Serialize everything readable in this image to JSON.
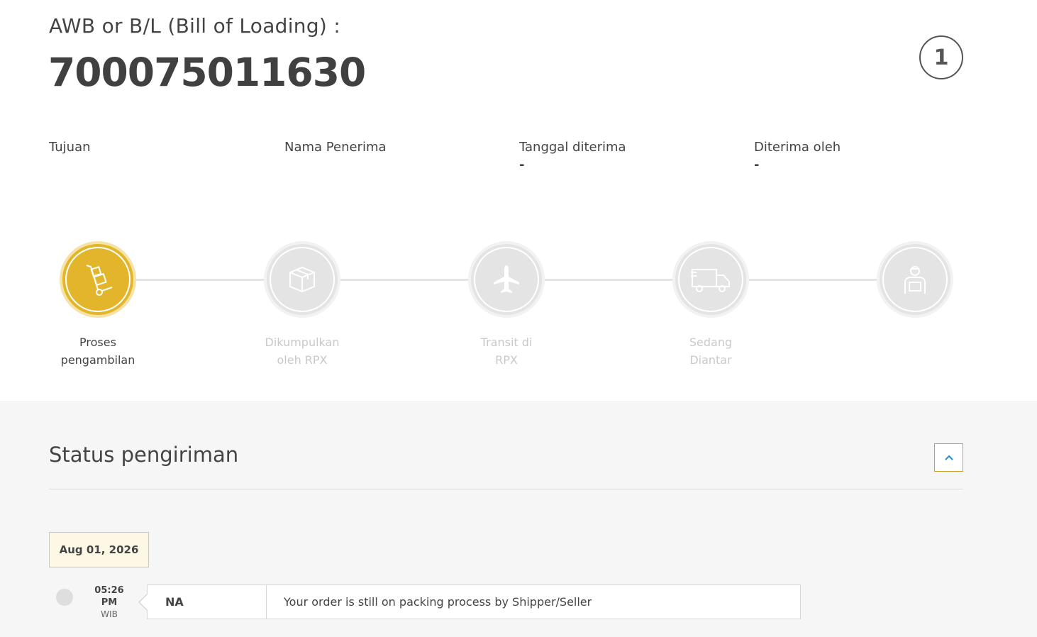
{
  "awb": {
    "label": "AWB or B/L (Bill of Loading) :",
    "number": "700075011630",
    "count": "1"
  },
  "info": [
    {
      "label": "Tujuan",
      "value": ""
    },
    {
      "label": "Nama Penerima",
      "value": ""
    },
    {
      "label": "Tanggal diterima",
      "value": "-"
    },
    {
      "label": "Diterima oleh",
      "value": "-"
    }
  ],
  "steps": [
    {
      "label_line1": "Proses",
      "label_line2": "pengambilan",
      "icon": "hand-truck-icon",
      "active": true
    },
    {
      "label_line1": "Dikumpulkan",
      "label_line2": "oleh RPX",
      "icon": "package-box-icon",
      "active": false
    },
    {
      "label_line1": "Transit di",
      "label_line2": "RPX",
      "icon": "airplane-icon",
      "active": false
    },
    {
      "label_line1": "Sedang",
      "label_line2": "Diantar",
      "icon": "delivery-truck-icon",
      "active": false
    },
    {
      "label_line1": "",
      "label_line2": "",
      "icon": "courier-icon",
      "active": false
    }
  ],
  "status": {
    "title": "Status pengiriman",
    "collapse_icon": "chevron-up-icon",
    "date": "Aug 01, 2026",
    "events": [
      {
        "time": "05:26",
        "ampm": "PM",
        "tz": "WIB",
        "location": "NA",
        "description": "Your order is still on packing process by Shipper/Seller"
      }
    ]
  },
  "colors": {
    "accent": "#e3b52a",
    "inactive": "#e4e4e4",
    "chevron": "#1a8fd6"
  }
}
